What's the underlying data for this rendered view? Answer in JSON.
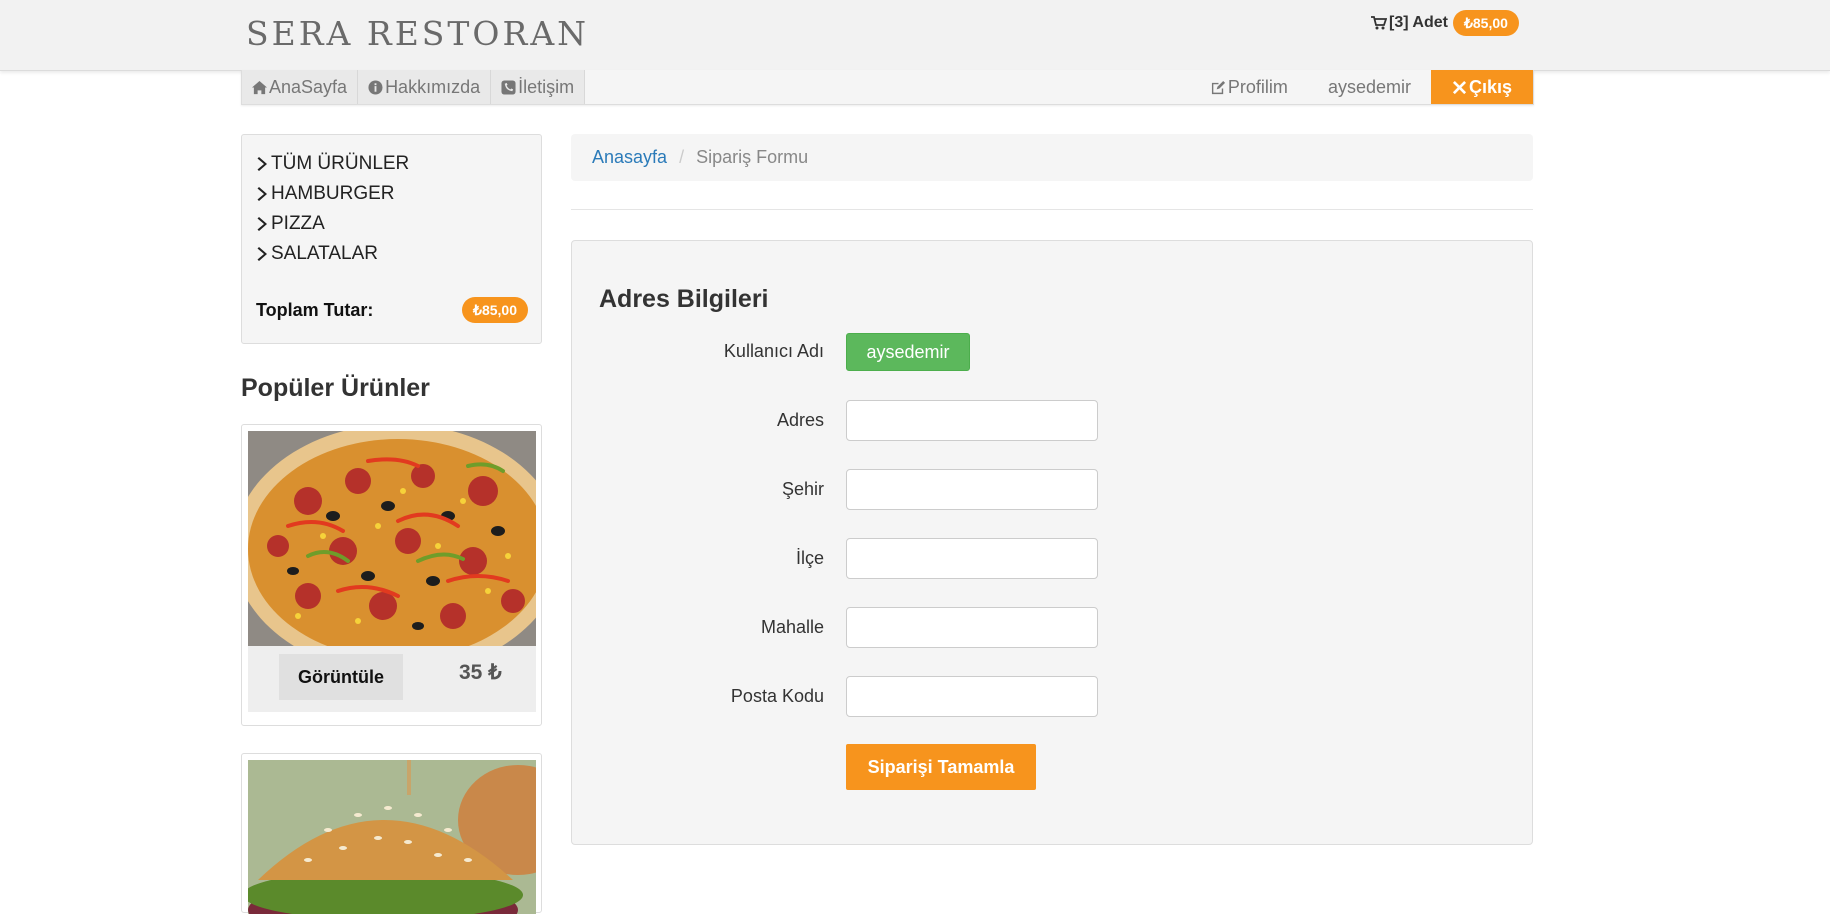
{
  "header": {
    "logo": "SERA RESTORAN",
    "cart": {
      "count_text": "[3] Adet",
      "total": "₺85,00",
      "icon": "cart-icon"
    }
  },
  "nav": {
    "left": [
      {
        "label": "AnaSayfa",
        "icon": "home-icon"
      },
      {
        "label": "Hakkımızda",
        "icon": "info-icon"
      },
      {
        "label": "İletişim",
        "icon": "phone-icon"
      }
    ],
    "right": [
      {
        "label": "Profilim",
        "icon": "edit-icon"
      },
      {
        "label": "aysedemir"
      },
      {
        "label": "Çıkış",
        "icon": "close-icon"
      }
    ]
  },
  "sidebar": {
    "categories": [
      {
        "label": "TÜM ÜRÜNLER"
      },
      {
        "label": "HAMBURGER"
      },
      {
        "label": "PIZZA"
      },
      {
        "label": "SALATALAR"
      }
    ],
    "total_label": "Toplam Tutar:",
    "total_value": "₺85,00",
    "popular_title": "Popüler Ürünler",
    "products": [
      {
        "image": "pizza-image",
        "button": "Görüntüle",
        "price": "35 ₺"
      },
      {
        "image": "hamburger-image"
      }
    ]
  },
  "breadcrumb": {
    "home": "Anasayfa",
    "separator": "/",
    "current": "Sipariş Formu"
  },
  "form": {
    "title": "Adres Bilgileri",
    "username_label": "Kullanıcı Adı",
    "username_value": "aysedemir",
    "fields": [
      {
        "label": "Adres",
        "value": ""
      },
      {
        "label": "Şehir",
        "value": ""
      },
      {
        "label": "İlçe",
        "value": ""
      },
      {
        "label": "Mahalle",
        "value": ""
      },
      {
        "label": "Posta Kodu",
        "value": ""
      }
    ],
    "submit": "Siparişi Tamamla"
  },
  "colors": {
    "accent": "#f7941d",
    "success": "#5cb85c",
    "link": "#2b7bb9"
  }
}
